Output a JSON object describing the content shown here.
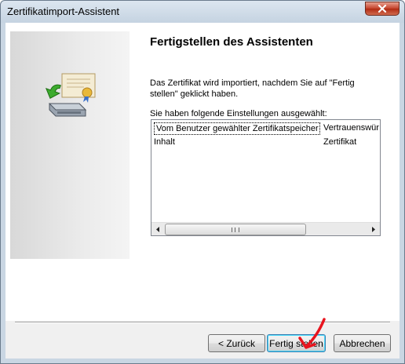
{
  "window": {
    "title": "Zertifikatimport-Assistent"
  },
  "page": {
    "heading": "Fertigstellen des Assistenten",
    "info_text": "Das Zertifikat wird importiert, nachdem Sie auf \"Fertig stellen\" geklickt haben.",
    "settings_label": "Sie haben folgende Einstellungen ausgewählt:"
  },
  "settings": {
    "rows": [
      {
        "key": "Vom Benutzer gewählter Zertifikatspeicher",
        "value": "Vertrauenswür"
      },
      {
        "key": "Inhalt",
        "value": "Zertifikat"
      }
    ]
  },
  "buttons": {
    "back": "< Zurück",
    "finish": "Fertig stellen",
    "cancel": "Abbrechen"
  },
  "icons": {
    "close": "close-icon",
    "wizard": "certificate-import-icon",
    "scroll_left": "scroll-left-arrow-icon",
    "scroll_right": "scroll-right-arrow-icon",
    "annotation": "red-arrow-annotation"
  },
  "colors": {
    "annotation": "#e8141e",
    "focus_button_border": "#3c7fb1"
  }
}
